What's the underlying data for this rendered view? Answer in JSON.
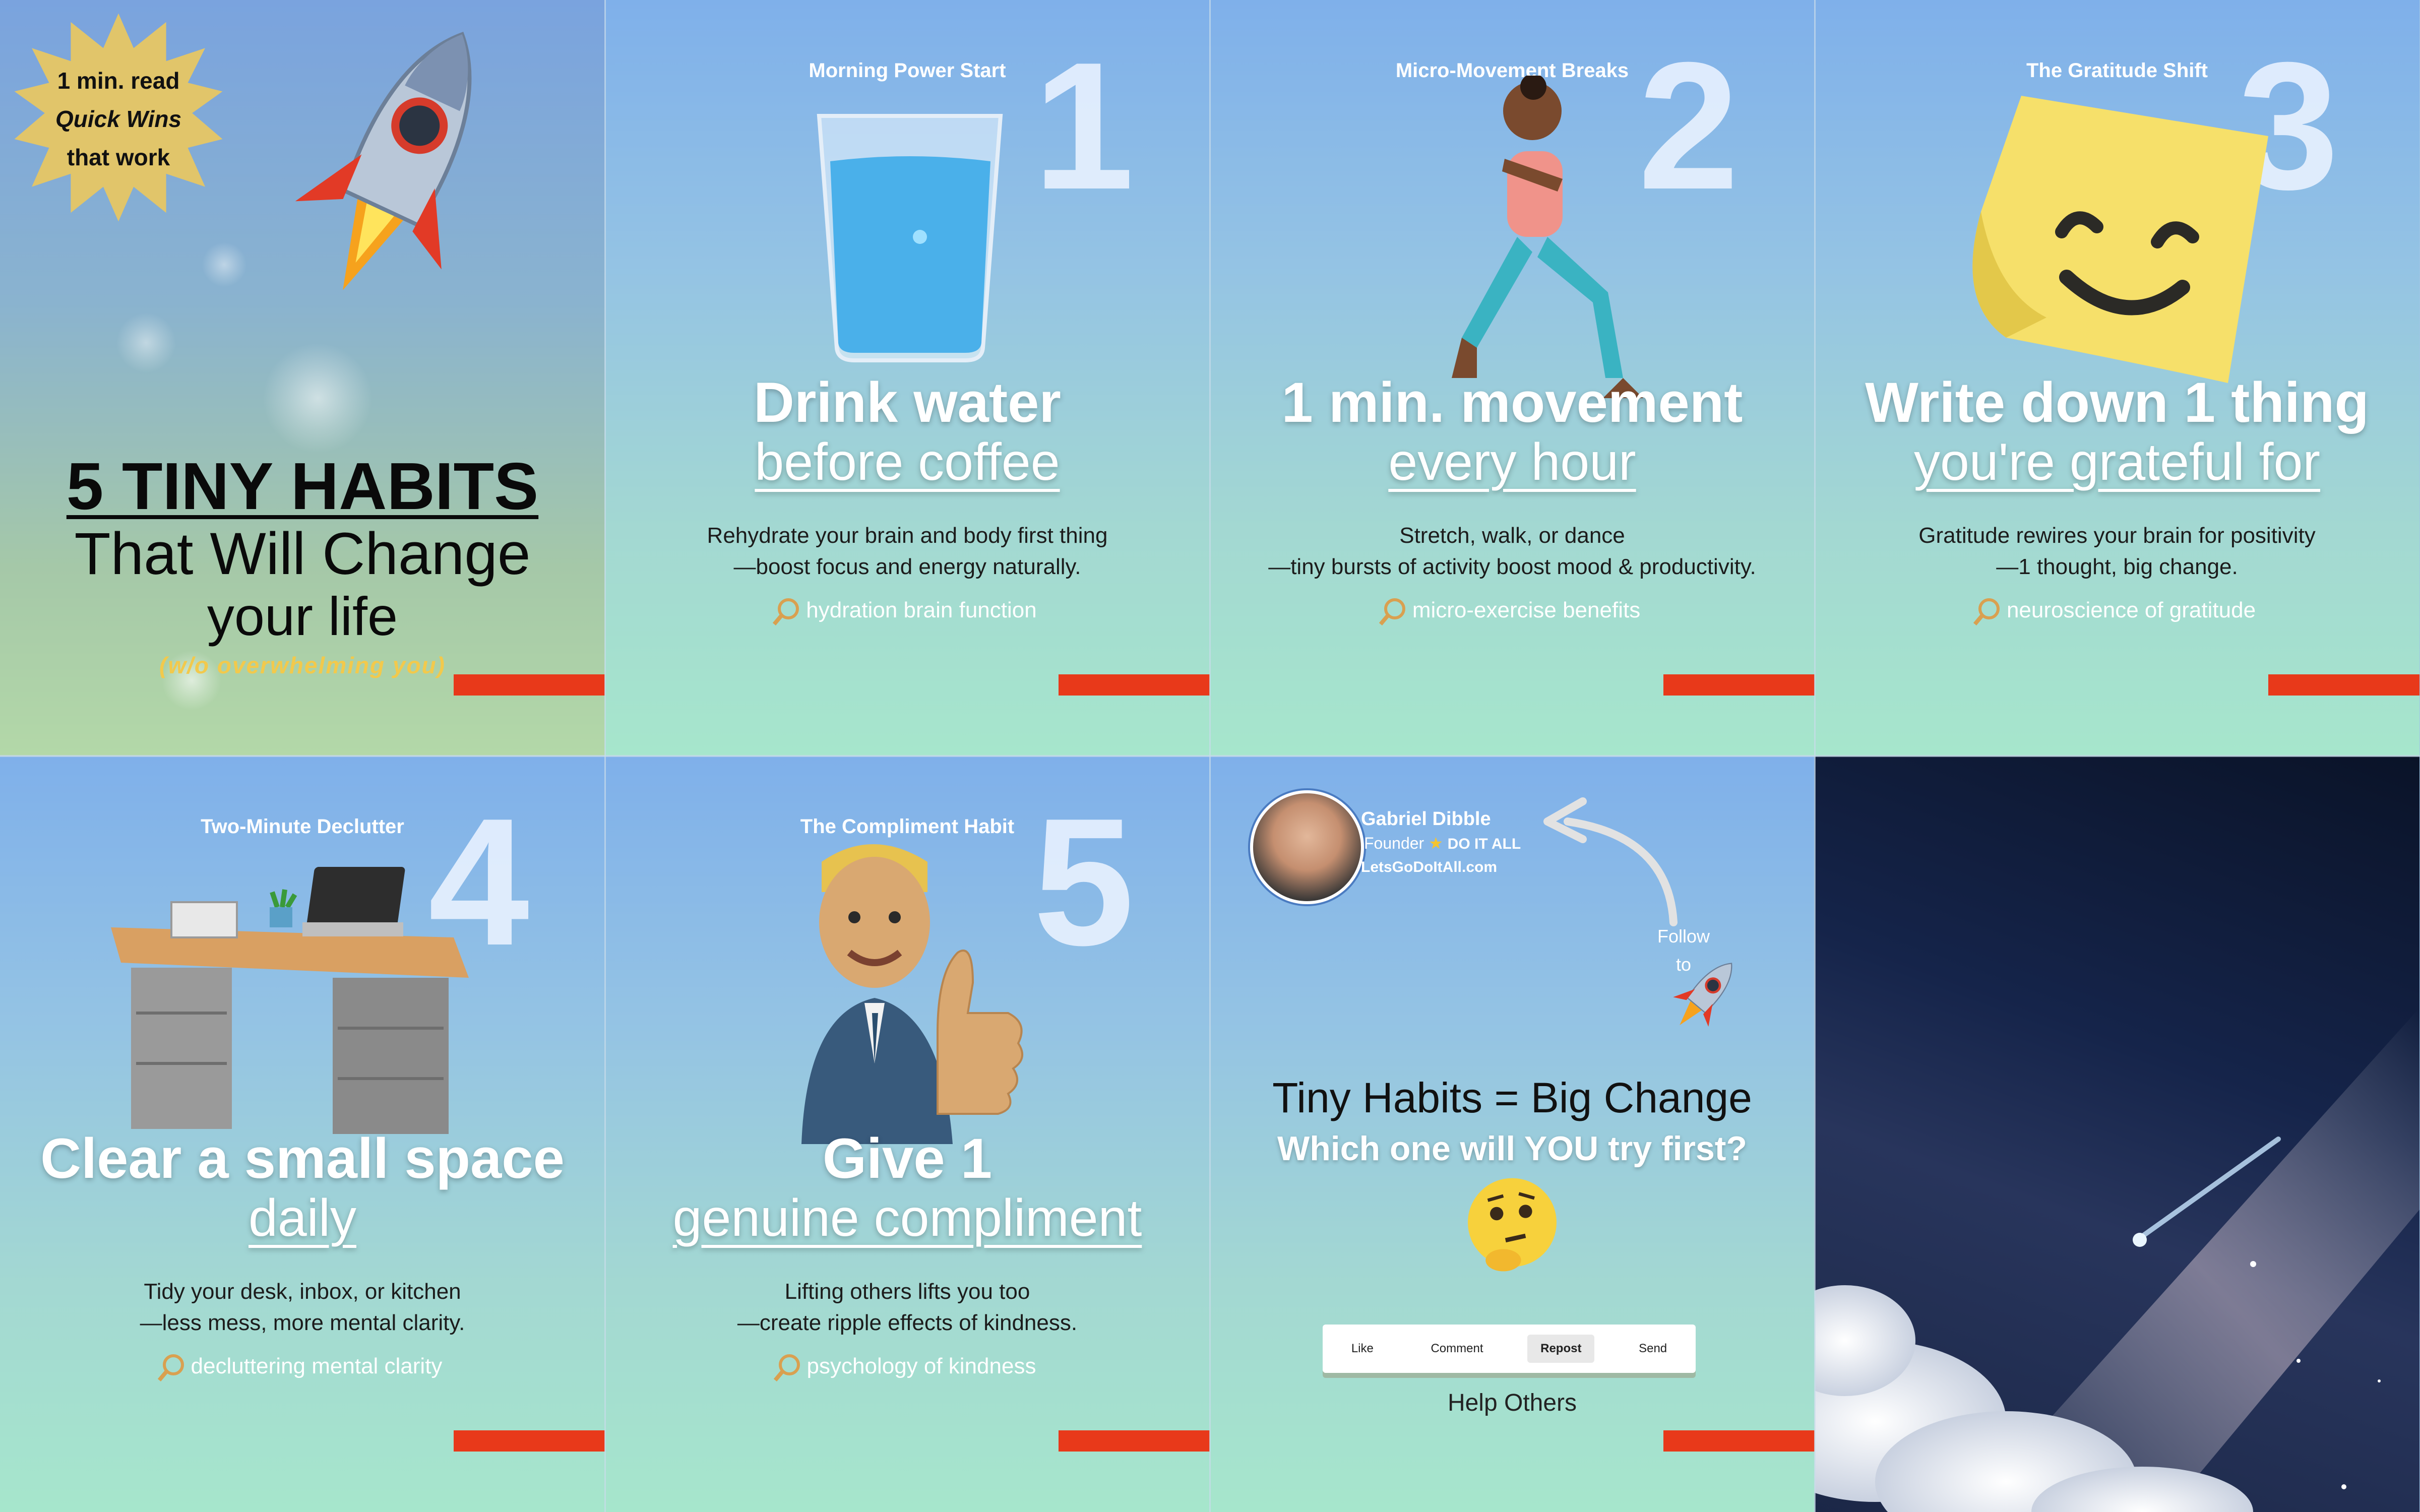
{
  "tile1": {
    "badge_line1": "1 min. read",
    "badge_line2": "Quick Wins",
    "badge_line3": "that work",
    "title_line1": "5 TINY HABITS",
    "title_line2": "That Will Change",
    "title_line3": "your life",
    "subtitle": "(w/o overwhelming you)",
    "icon": "rocket-icon"
  },
  "habits": [
    {
      "kicker": "Morning Power Start",
      "number": "1",
      "head1": "Drink water",
      "head2": "before coffee",
      "body1": "Rehydrate your brain and body first thing",
      "body2": "—boost focus and energy naturally.",
      "search": "hydration brain function",
      "icon": "water-glass-icon"
    },
    {
      "kicker": "Micro-Movement Breaks",
      "number": "2",
      "head1": "1 min. movement",
      "head2": "every hour",
      "body1": "Stretch, walk, or dance",
      "body2": "—tiny bursts of activity boost mood & productivity.",
      "search": "micro-exercise benefits",
      "icon": "woman-lunge-icon"
    },
    {
      "kicker": "The Gratitude Shift",
      "number": "3",
      "head1": "Write down 1 thing",
      "head2": "you're grateful for",
      "body1": "Gratitude rewires your brain for positivity",
      "body2": "—1 thought, big change.",
      "search": "neuroscience of gratitude",
      "icon": "smiley-sticky-note-icon"
    },
    {
      "kicker": "Two-Minute Declutter",
      "number": "4",
      "head1": "Clear a small space",
      "head2": "daily",
      "body1": "Tidy your desk, inbox, or kitchen",
      "body2": "—less mess, more mental clarity.",
      "search": "decluttering mental clarity",
      "icon": "desk-icon"
    },
    {
      "kicker": "The Compliment Habit",
      "number": "5",
      "head1": "Give 1",
      "head2": "genuine compliment",
      "body1": "Lifting others lifts you too",
      "body2": "—create ripple effects of kindness.",
      "search": "psychology of kindness",
      "icon": "thumbs-up-man-icon"
    }
  ],
  "tile7": {
    "name": "Gabriel Dibble",
    "role": "Founder",
    "role_tag": "DO IT ALL",
    "url": "LetsGoDoItAll.com",
    "follow1": "Follow",
    "follow2": "to",
    "headline": "Tiny Habits = Big Change",
    "question": "Which one will YOU try first?",
    "actions": [
      "Like",
      "Comment",
      "Repost",
      "Send"
    ],
    "active_action": "Repost",
    "help": "Help Others",
    "icons": [
      "rocket-icon",
      "thinking-face-icon",
      "curved-arrow-icon"
    ]
  },
  "tile8": {
    "icon": "shooting-star-sky-image"
  },
  "colors": {
    "accent_red": "#e8391a",
    "badge_gold": "#e1c56a",
    "bg_top": "#7fb0ea",
    "bg_bottom": "#a6e6cc"
  }
}
